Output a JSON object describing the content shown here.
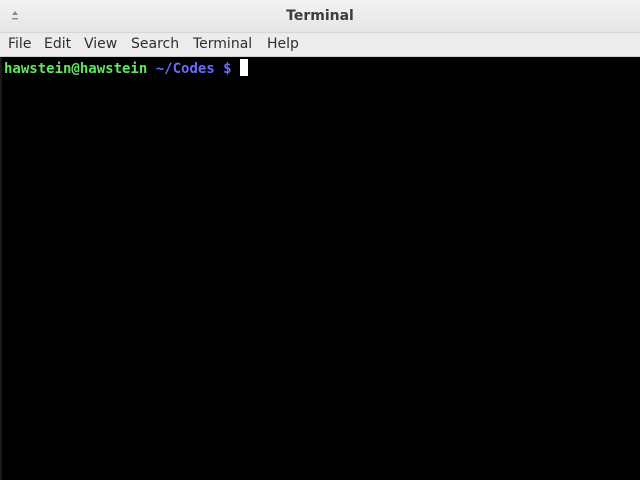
{
  "window": {
    "title": "Terminal",
    "menu_icon": "window-menu-icon"
  },
  "menubar": {
    "items": [
      "File",
      "Edit",
      "View",
      "Search",
      "Terminal",
      "Help"
    ]
  },
  "terminal": {
    "user_host": "hawstein@hawstein",
    "cwd": "~/Codes $",
    "colors": {
      "user_host": "#5fe85f",
      "cwd": "#6b6bff",
      "background": "#000000",
      "cursor": "#ffffff"
    }
  }
}
